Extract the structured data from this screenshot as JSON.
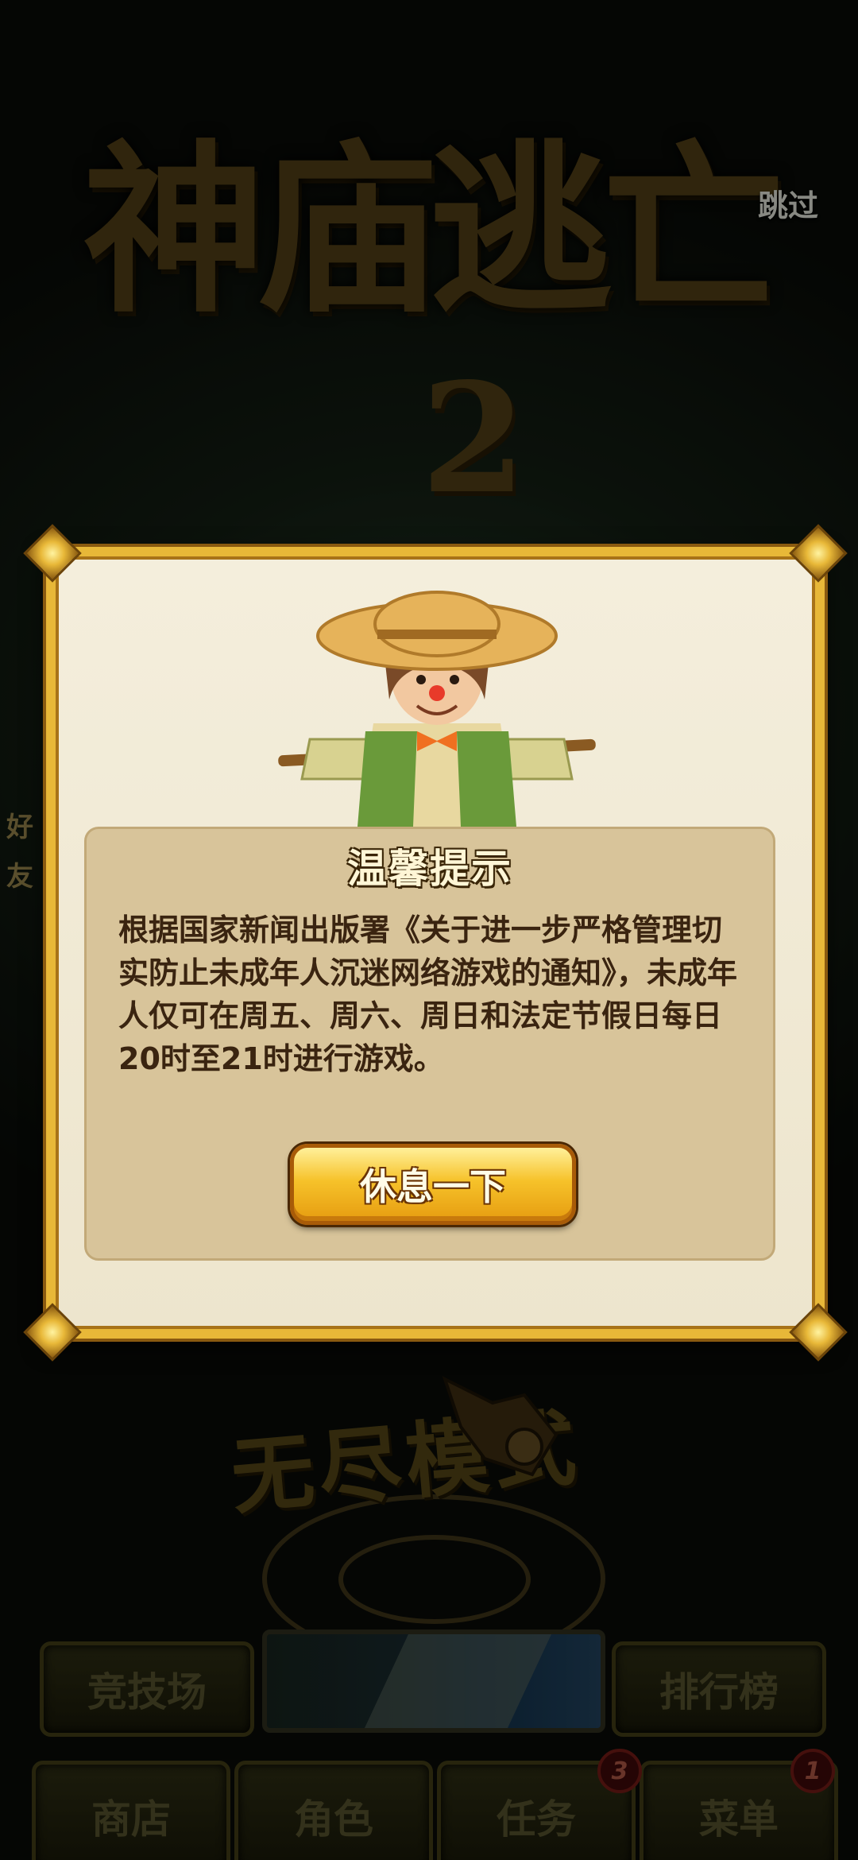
{
  "game": {
    "logo_text": "神庙逃亡",
    "logo_number": "2",
    "skip_label": "跳过",
    "friends_label": "好友",
    "mode_label": "无尽模式"
  },
  "dialog": {
    "title": "温馨提示",
    "message": "根据国家新闻出版署《关于进一步严格管理切实防止未成年人沉迷网络游戏的通知》，未成年人仅可在周五、周六、周日和法定节假日每日20时至21时进行游戏。",
    "button_label": "休息一下"
  },
  "nav": {
    "arena": "竞技场",
    "leaderboard": "排行榜",
    "tabs": [
      {
        "label": "商店"
      },
      {
        "label": "角色"
      },
      {
        "label": "任务",
        "badge": "3"
      },
      {
        "label": "菜单",
        "badge": "1"
      }
    ]
  },
  "colors": {
    "frame_gold": "#e8b838",
    "dialog_bg": "#f4eedc",
    "panel_bg": "#d8c49a",
    "button_gold": "#f6c22a"
  }
}
